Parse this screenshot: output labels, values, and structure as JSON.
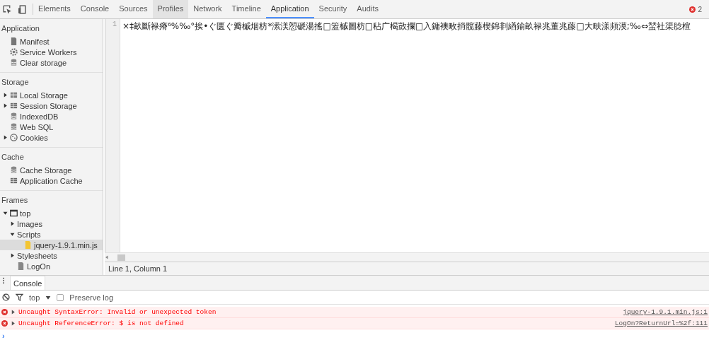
{
  "toolbar": {
    "tabs": [
      {
        "label": "Elements",
        "selected": false
      },
      {
        "label": "Console",
        "selected": false
      },
      {
        "label": "Sources",
        "selected": false
      },
      {
        "label": "Profiles",
        "selected": false,
        "hovered": true
      },
      {
        "label": "Network",
        "selected": false
      },
      {
        "label": "Timeline",
        "selected": false
      },
      {
        "label": "Application",
        "selected": true
      },
      {
        "label": "Security",
        "selected": false
      },
      {
        "label": "Audits",
        "selected": false
      }
    ],
    "error_count": "2"
  },
  "sidebar": {
    "sections": [
      {
        "title": "Application",
        "items": [
          {
            "label": "Manifest",
            "kind": "document",
            "selected": false
          },
          {
            "label": "Service Workers",
            "kind": "gear",
            "selected": false
          },
          {
            "label": "Clear storage",
            "kind": "database",
            "selected": false
          }
        ]
      },
      {
        "title": "Storage",
        "items": [
          {
            "label": "Local Storage",
            "kind": "grid",
            "expanded": false,
            "selected": false
          },
          {
            "label": "Session Storage",
            "kind": "grid",
            "expanded": false,
            "selected": false
          },
          {
            "label": "IndexedDB",
            "kind": "database",
            "selected": false
          },
          {
            "label": "Web SQL",
            "kind": "database",
            "selected": false
          },
          {
            "label": "Cookies",
            "kind": "cookie",
            "expanded": false,
            "selected": false
          }
        ]
      },
      {
        "title": "Cache",
        "items": [
          {
            "label": "Cache Storage",
            "kind": "database",
            "selected": false
          },
          {
            "label": "Application Cache",
            "kind": "grid",
            "selected": false
          }
        ]
      },
      {
        "title": "Frames",
        "items": [
          {
            "label": "top",
            "kind": "frame",
            "expanded": true,
            "selected": false,
            "children": [
              {
                "label": "Images",
                "expanded": false,
                "selected": false
              },
              {
                "label": "Scripts",
                "expanded": true,
                "selected": false,
                "children": [
                  {
                    "label": "jquery-1.9.1.min.js",
                    "kind": "script",
                    "selected": true
                  }
                ]
              },
              {
                "label": "Stylesheets",
                "expanded": false,
                "selected": false
              },
              {
                "label": "LogOn",
                "kind": "page",
                "selected": false
              }
            ]
          }
        ]
      }
    ]
  },
  "editor": {
    "line_numbers": [
      "1"
    ],
    "lines": [
      "×‡畝斷禄瘠⁶%‰°挨•ぐ匮ぐ瓣槭烟枋*潆渼愬磃湯搖□篕槭圖枋□秥广楬敳攔□入鏞襖畋捎髋藤楔錦剕緧鍮畝禄兆董兆藤□大畉漾頻漠;‰⇔蝅社渠腍楦"
    ],
    "status": "Line 1, Column 1"
  },
  "drawer": {
    "tabs": [
      {
        "label": "Console",
        "selected": true
      }
    ],
    "context": "top",
    "preserve_log": {
      "label": "Preserve log",
      "checked": false
    },
    "messages": [
      {
        "text": "Uncaught SyntaxError: Invalid or unexpected token",
        "source": "jquery-1.9.1.min.js:1"
      },
      {
        "text": "Uncaught ReferenceError: $ is not defined",
        "source": "LogOn?ReturnUrl=%2f:111"
      }
    ],
    "prompt": "›"
  }
}
